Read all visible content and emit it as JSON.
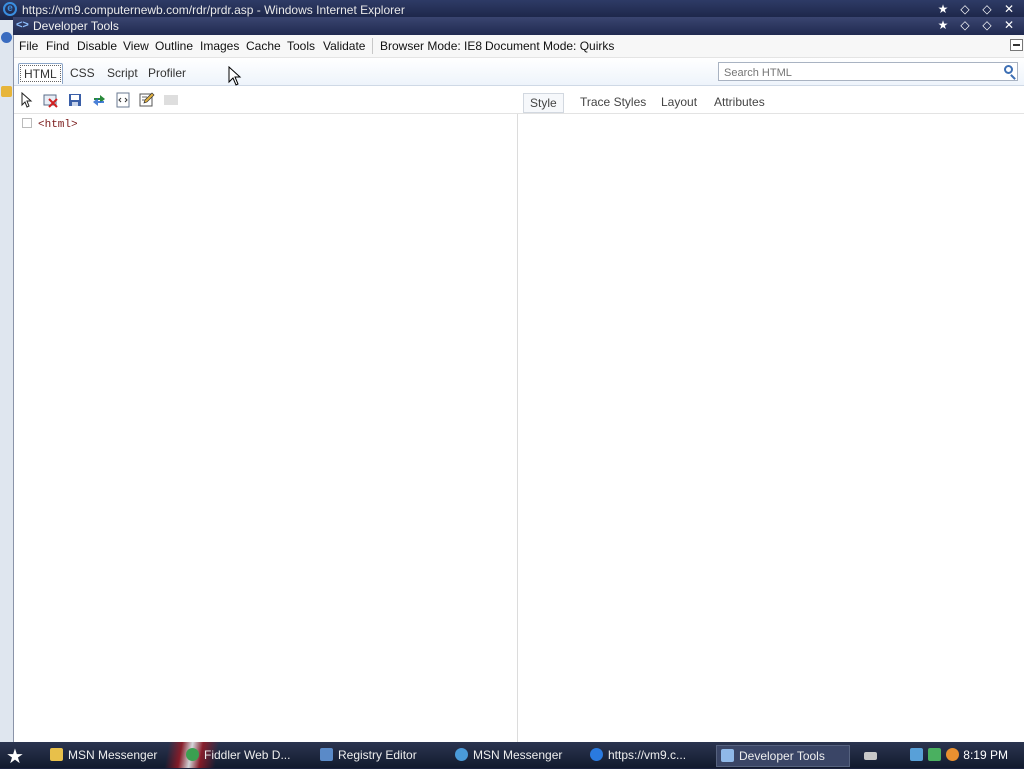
{
  "ie_window": {
    "title": "https://vm9.computernewb.com/rdr/prdr.asp - Windows Internet Explorer"
  },
  "devtools": {
    "title": "Developer Tools",
    "menu": [
      "File",
      "Find",
      "Disable",
      "View",
      "Outline",
      "Images",
      "Cache",
      "Tools",
      "Validate"
    ],
    "browser_mode_label": "Browser Mode: IE8",
    "document_mode_label": "Document Mode: Quirks",
    "tabs": [
      "HTML",
      "CSS",
      "Script",
      "Profiler"
    ],
    "active_tab": "HTML",
    "search_placeholder": "Search HTML",
    "toolbar_icons": [
      "select-element-icon",
      "clear-icon",
      "save-icon",
      "refresh-icon",
      "word-wrap-icon",
      "edit-icon",
      "disabled-icon"
    ],
    "right_tabs": [
      "Style",
      "Trace Styles",
      "Layout",
      "Attributes"
    ],
    "active_right_tab": "Style",
    "tree_root": "<html>"
  },
  "taskbar": {
    "items": [
      "MSN Messenger",
      "Fiddler Web D...",
      "Registry Editor",
      "MSN Messenger",
      "https://vm9.c...",
      "Developer Tools"
    ],
    "active_item": "Developer Tools",
    "clock": "8:19 PM"
  },
  "colors": {
    "titlebar": "#2e3b66",
    "taskbar": "#121a2e",
    "tree_tag": "#7a1a1a"
  }
}
